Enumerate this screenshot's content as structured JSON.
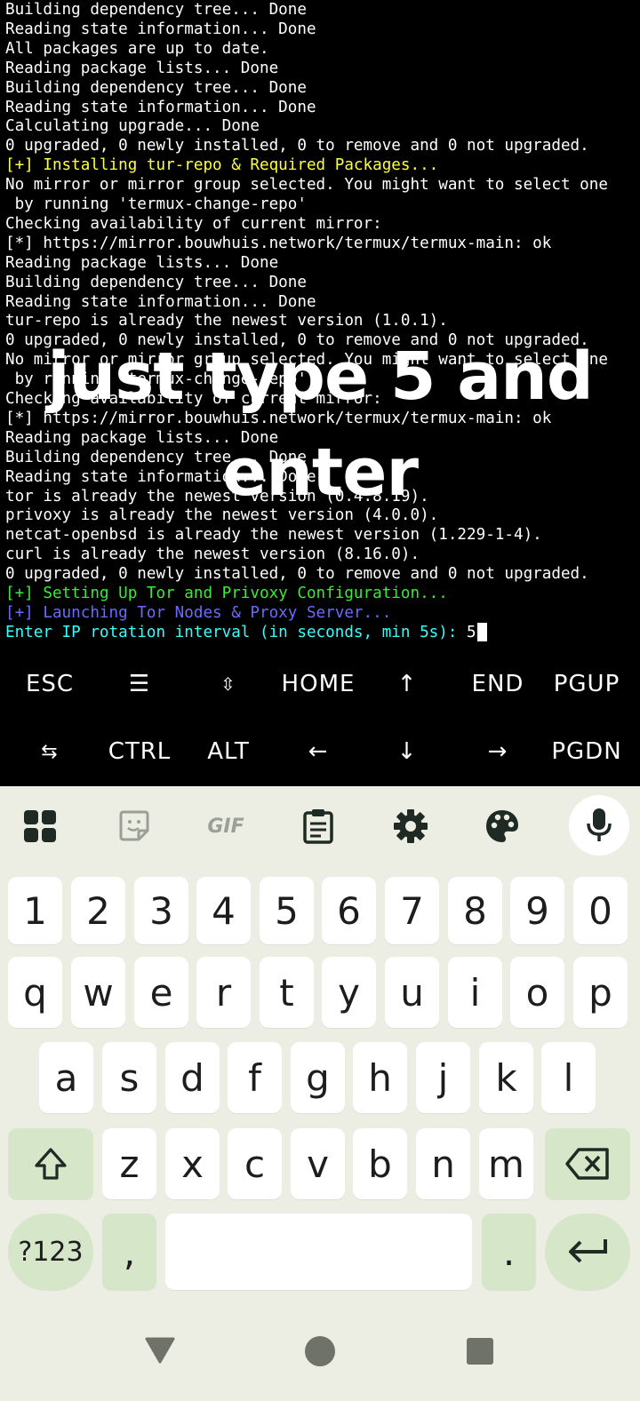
{
  "terminal": {
    "lines": [
      {
        "text": "Building dependency tree... Done",
        "color": "#ffffff"
      },
      {
        "text": "Reading state information... Done",
        "color": "#ffffff"
      },
      {
        "text": "All packages are up to date.",
        "color": "#ffffff"
      },
      {
        "text": "Reading package lists... Done",
        "color": "#ffffff"
      },
      {
        "text": "Building dependency tree... Done",
        "color": "#ffffff"
      },
      {
        "text": "Reading state information... Done",
        "color": "#ffffff"
      },
      {
        "text": "Calculating upgrade... Done",
        "color": "#ffffff"
      },
      {
        "text": "0 upgraded, 0 newly installed, 0 to remove and 0 not upgraded.",
        "color": "#ffffff"
      },
      {
        "text": "[+] Installing tur-repo & Required Packages...",
        "color": "#ffff3c"
      },
      {
        "text": "No mirror or mirror group selected. You might want to select one",
        "color": "#ffffff"
      },
      {
        "text": " by running 'termux-change-repo'",
        "color": "#ffffff"
      },
      {
        "text": "Checking availability of current mirror:",
        "color": "#ffffff"
      },
      {
        "text": "[*] https://mirror.bouwhuis.network/termux/termux-main: ok",
        "color": "#ffffff"
      },
      {
        "text": "Reading package lists... Done",
        "color": "#ffffff"
      },
      {
        "text": "Building dependency tree... Done",
        "color": "#ffffff"
      },
      {
        "text": "Reading state information... Done",
        "color": "#ffffff"
      },
      {
        "text": "tur-repo is already the newest version (1.0.1).",
        "color": "#ffffff"
      },
      {
        "text": "0 upgraded, 0 newly installed, 0 to remove and 0 not upgraded.",
        "color": "#ffffff"
      },
      {
        "text": "No mirror or mirror group selected. You might want to select one",
        "color": "#ffffff"
      },
      {
        "text": " by running 'termux-change-repo'",
        "color": "#ffffff"
      },
      {
        "text": "Checking availability of current mirror:",
        "color": "#ffffff"
      },
      {
        "text": "[*] https://mirror.bouwhuis.network/termux/termux-main: ok",
        "color": "#ffffff"
      },
      {
        "text": "Reading package lists... Done",
        "color": "#ffffff"
      },
      {
        "text": "Building dependency tree... Done",
        "color": "#ffffff"
      },
      {
        "text": "Reading state information... Done",
        "color": "#ffffff"
      },
      {
        "text": "tor is already the newest version (0.4.8.19).",
        "color": "#ffffff"
      },
      {
        "text": "privoxy is already the newest version (4.0.0).",
        "color": "#ffffff"
      },
      {
        "text": "netcat-openbsd is already the newest version (1.229-1-4).",
        "color": "#ffffff"
      },
      {
        "text": "curl is already the newest version (8.16.0).",
        "color": "#ffffff"
      },
      {
        "text": "0 upgraded, 0 newly installed, 0 to remove and 0 not upgraded.",
        "color": "#ffffff"
      },
      {
        "text": "[+] Setting Up Tor and Privoxy Configuration...",
        "color": "#33ee33"
      },
      {
        "text": "[+] Launching Tor Nodes & Proxy Server...",
        "color": "#6a6aff"
      }
    ],
    "prompt": "Enter IP rotation interval (in seconds, min 5s): ",
    "prompt_color": "#33ffff",
    "input_value": "5"
  },
  "overlay": {
    "line1": "just type 5 and",
    "line2": "enter"
  },
  "extra_keys": {
    "row1": [
      "ESC",
      "☰",
      "⇳",
      "HOME",
      "↑",
      "END",
      "PGUP"
    ],
    "row2": [
      "⇆",
      "CTRL",
      "ALT",
      "←",
      "↓",
      "→",
      "PGDN"
    ]
  },
  "keyboard": {
    "toolbar": [
      "apps-grid-icon",
      "sticker-icon",
      "gif-icon",
      "clipboard-icon",
      "settings-gear-icon",
      "theme-palette-icon",
      "microphone-icon"
    ],
    "gif_label": "GIF",
    "row_numbers": [
      "1",
      "2",
      "3",
      "4",
      "5",
      "6",
      "7",
      "8",
      "9",
      "0"
    ],
    "row_q": [
      "q",
      "w",
      "e",
      "r",
      "t",
      "y",
      "u",
      "i",
      "o",
      "p"
    ],
    "row_a": [
      "a",
      "s",
      "d",
      "f",
      "g",
      "h",
      "j",
      "k",
      "l"
    ],
    "row_z": [
      "z",
      "x",
      "c",
      "v",
      "b",
      "n",
      "m"
    ],
    "symbols_label": "?123",
    "comma_label": ",",
    "period_label": ".",
    "accent_color": "#d6e6c8",
    "background_color": "#ecede3"
  },
  "navbar": [
    "back-triangle-icon",
    "home-circle-icon",
    "recents-square-icon"
  ]
}
